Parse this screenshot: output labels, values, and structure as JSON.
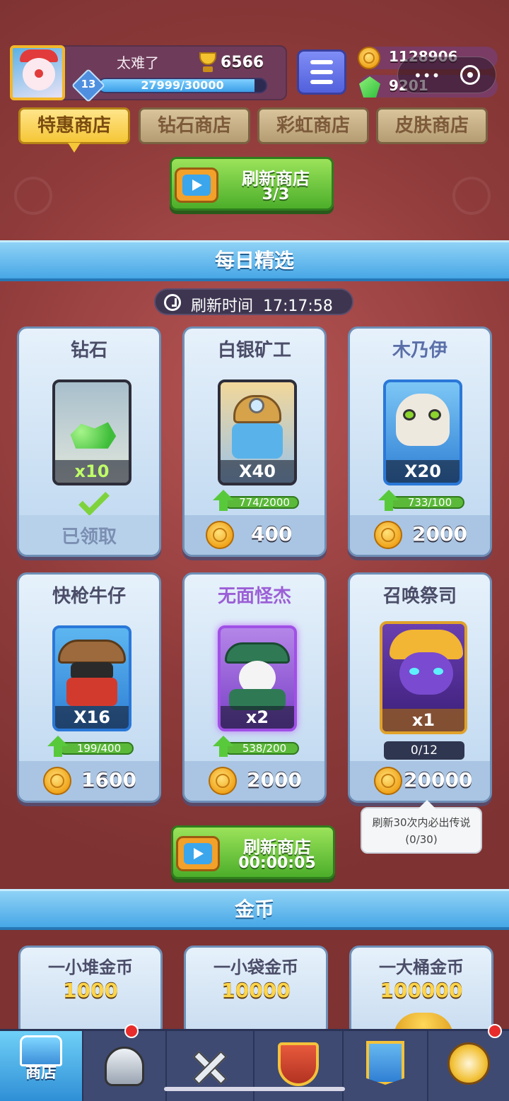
{
  "player": {
    "name": "太难了",
    "trophies": "6566",
    "level": "13",
    "xp_text": "27999/30000",
    "xp_progress": 0.933
  },
  "currency": {
    "gold": "1128906",
    "gems": "9201"
  },
  "tabs": [
    {
      "label": "特惠商店",
      "active": true
    },
    {
      "label": "钻石商店",
      "active": false
    },
    {
      "label": "彩虹商店",
      "active": false
    },
    {
      "label": "皮肤商店",
      "active": false
    }
  ],
  "refresh_top": {
    "label": "刷新商店",
    "count": "3/3"
  },
  "daily": {
    "title": "每日精选",
    "timer_label": "刷新时间",
    "timer_value": "17:17:58",
    "items": [
      {
        "name": "钻石",
        "qty": "x10",
        "status": "已领取",
        "icon": "gem-pile-icon"
      },
      {
        "name": "白银矿工",
        "qty": "X40",
        "progress": "774/2000",
        "price": "400",
        "icon": "miner-icon"
      },
      {
        "name": "木乃伊",
        "qty": "X20",
        "progress": "733/100",
        "price": "2000",
        "icon": "mummy-icon"
      },
      {
        "name": "快枪牛仔",
        "qty": "X16",
        "progress": "199/400",
        "price": "1600",
        "icon": "cowboy-icon"
      },
      {
        "name": "无面怪杰",
        "qty": "x2",
        "progress": "538/200",
        "price": "2000",
        "icon": "faceless-icon"
      },
      {
        "name": "召唤祭司",
        "qty": "x1",
        "counter": "0/12",
        "price": "20000",
        "icon": "summoner-icon"
      }
    ]
  },
  "tooltip": {
    "line1": "刷新30次内必出传说",
    "line2": "(0/30)"
  },
  "refresh_bottom": {
    "label": "刷新商店",
    "countdown": "00:00:05"
  },
  "gold_section": {
    "title": "金币",
    "items": [
      {
        "name": "一小堆金币",
        "amount": "1000"
      },
      {
        "name": "一小袋金币",
        "amount": "10000"
      },
      {
        "name": "一大桶金币",
        "amount": "100000"
      }
    ]
  },
  "nav": [
    {
      "label": "商店",
      "icon": "shop-chest-icon",
      "active": true
    },
    {
      "label": "",
      "icon": "knight-helmet-icon",
      "active": false
    },
    {
      "label": "",
      "icon": "crossed-swords-icon",
      "active": false
    },
    {
      "label": "",
      "icon": "crown-shield-icon",
      "active": false
    },
    {
      "label": "",
      "icon": "team-banner-icon",
      "active": false
    },
    {
      "label": "",
      "icon": "compass-icon",
      "active": false
    }
  ]
}
